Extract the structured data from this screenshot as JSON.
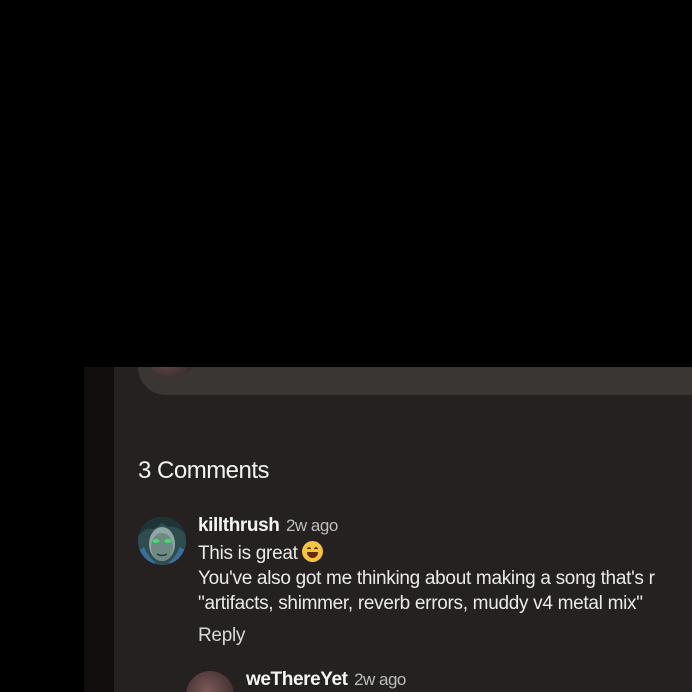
{
  "comments_section": {
    "heading": "3 Comments",
    "comments": [
      {
        "username": "killthrush",
        "time": "2w ago",
        "text_line_1": "This is great",
        "emoji": "grinning-squinting-face",
        "text_line_2": "You've also got me thinking about making a song that's r",
        "text_line_3": "\"artifacts, shimmer, reverb errors, muddy v4 metal mix\"",
        "reply_label": "Reply"
      }
    ],
    "replies": [
      {
        "username": "weThereYet",
        "time": "2w ago"
      }
    ]
  },
  "colors": {
    "page_background": "#000000",
    "panel_background": "#252120",
    "composer_background": "#3a3634",
    "text_primary": "#f4f4f4",
    "text_secondary": "#bdbdbd"
  }
}
